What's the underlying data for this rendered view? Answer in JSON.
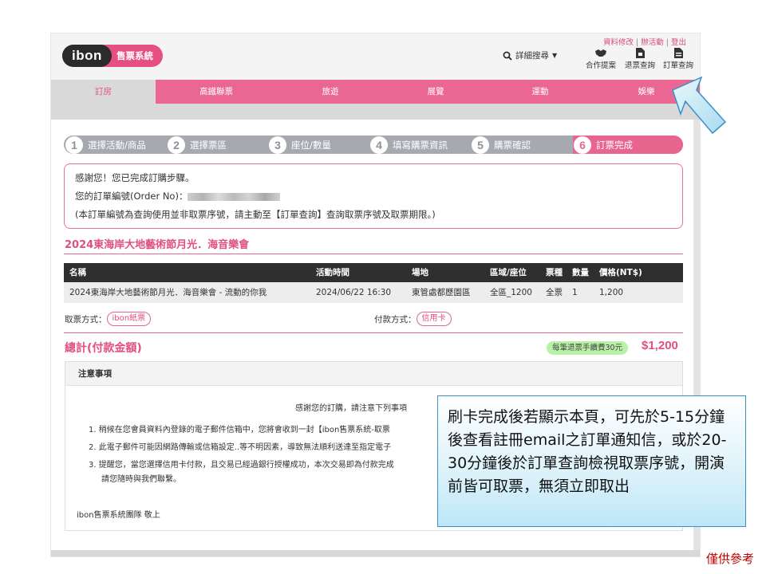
{
  "header": {
    "logo_ibon": "ibon",
    "logo_system": "售票系統",
    "top_links": [
      "資料修改",
      "辦活動",
      "登出"
    ],
    "search_label": "詳細搜尋",
    "tools": [
      {
        "label": "合作提案",
        "icon": "handshake-icon"
      },
      {
        "label": "退票查詢",
        "icon": "refund-doc-icon"
      },
      {
        "label": "訂單查詢",
        "icon": "order-doc-icon"
      }
    ]
  },
  "nav": [
    "訂房",
    "高鐵聯票",
    "旅遊",
    "展覽",
    "運動",
    "娛樂"
  ],
  "steps": [
    {
      "num": "1",
      "label": "選擇活動/商品"
    },
    {
      "num": "2",
      "label": "選擇票區"
    },
    {
      "num": "3",
      "label": "座位/數量"
    },
    {
      "num": "4",
      "label": "填寫購票資訊"
    },
    {
      "num": "5",
      "label": "購票確認"
    },
    {
      "num": "6",
      "label": "訂票完成"
    }
  ],
  "thanks": {
    "line1": "感謝您！您已完成訂購步驟。",
    "line2_label": "您的訂單編號(Order  No)：",
    "line3": "(本訂單編號為查詢使用並非取票序號，請主動至【訂單查詢】查詢取票序號及取票期限。)"
  },
  "event_title": "2024東海岸大地藝術節月光．海音樂會",
  "table": {
    "headers": [
      "名稱",
      "活動時間",
      "場地",
      "區域/座位",
      "票種",
      "數量",
      "價格(NT$)"
    ],
    "row": [
      "2024東海岸大地藝術節月光．海音樂會 - 流動的你我",
      "2024/06/22 16:30",
      "東管處都歷園區",
      "全區_1200",
      "全票",
      "1",
      "1,200"
    ]
  },
  "pickup": {
    "label": "取票方式：",
    "value": "ibon紙票"
  },
  "payment": {
    "label": "付款方式：",
    "value": "信用卡"
  },
  "total": {
    "label": "總計(付款金額)",
    "fee_badge": "每筆退票手續費30元",
    "amount": "$1,200"
  },
  "notice": {
    "title": "注意事項",
    "intro": "感謝您的訂購，請注意下列事項",
    "items": [
      "1.  稍候在您會員資料內登錄的電子郵件信箱中，您將會收到一封【ibon售票系統-取票",
      "2.  此電子郵件可能因網路傳輸或信箱設定..等不明因素，導致無法順利送達至指定電子",
      "3.  提醒您，當您選擇信用卡付款，且交易已經過銀行授權成功，本次交易即為付款完成"
    ],
    "item3_cont": "請您隨時與我們聯繫。",
    "signature": "ibon售票系統團隊  敬上"
  },
  "callout": "刷卡完成後若顯示本頁，可先於5-15分鐘後查看註冊email之訂單通知信，或於20-30分鐘後於訂單查詢檢視取票序號，開演前皆可取票，無須立即取出",
  "note_ref": "僅供參考",
  "colors": {
    "brand_pink": "#e8658f",
    "dark": "#2f2f2f",
    "step_gray": "#a6aab0",
    "callout_border": "#3b90c8",
    "note_red": "#c00000"
  }
}
